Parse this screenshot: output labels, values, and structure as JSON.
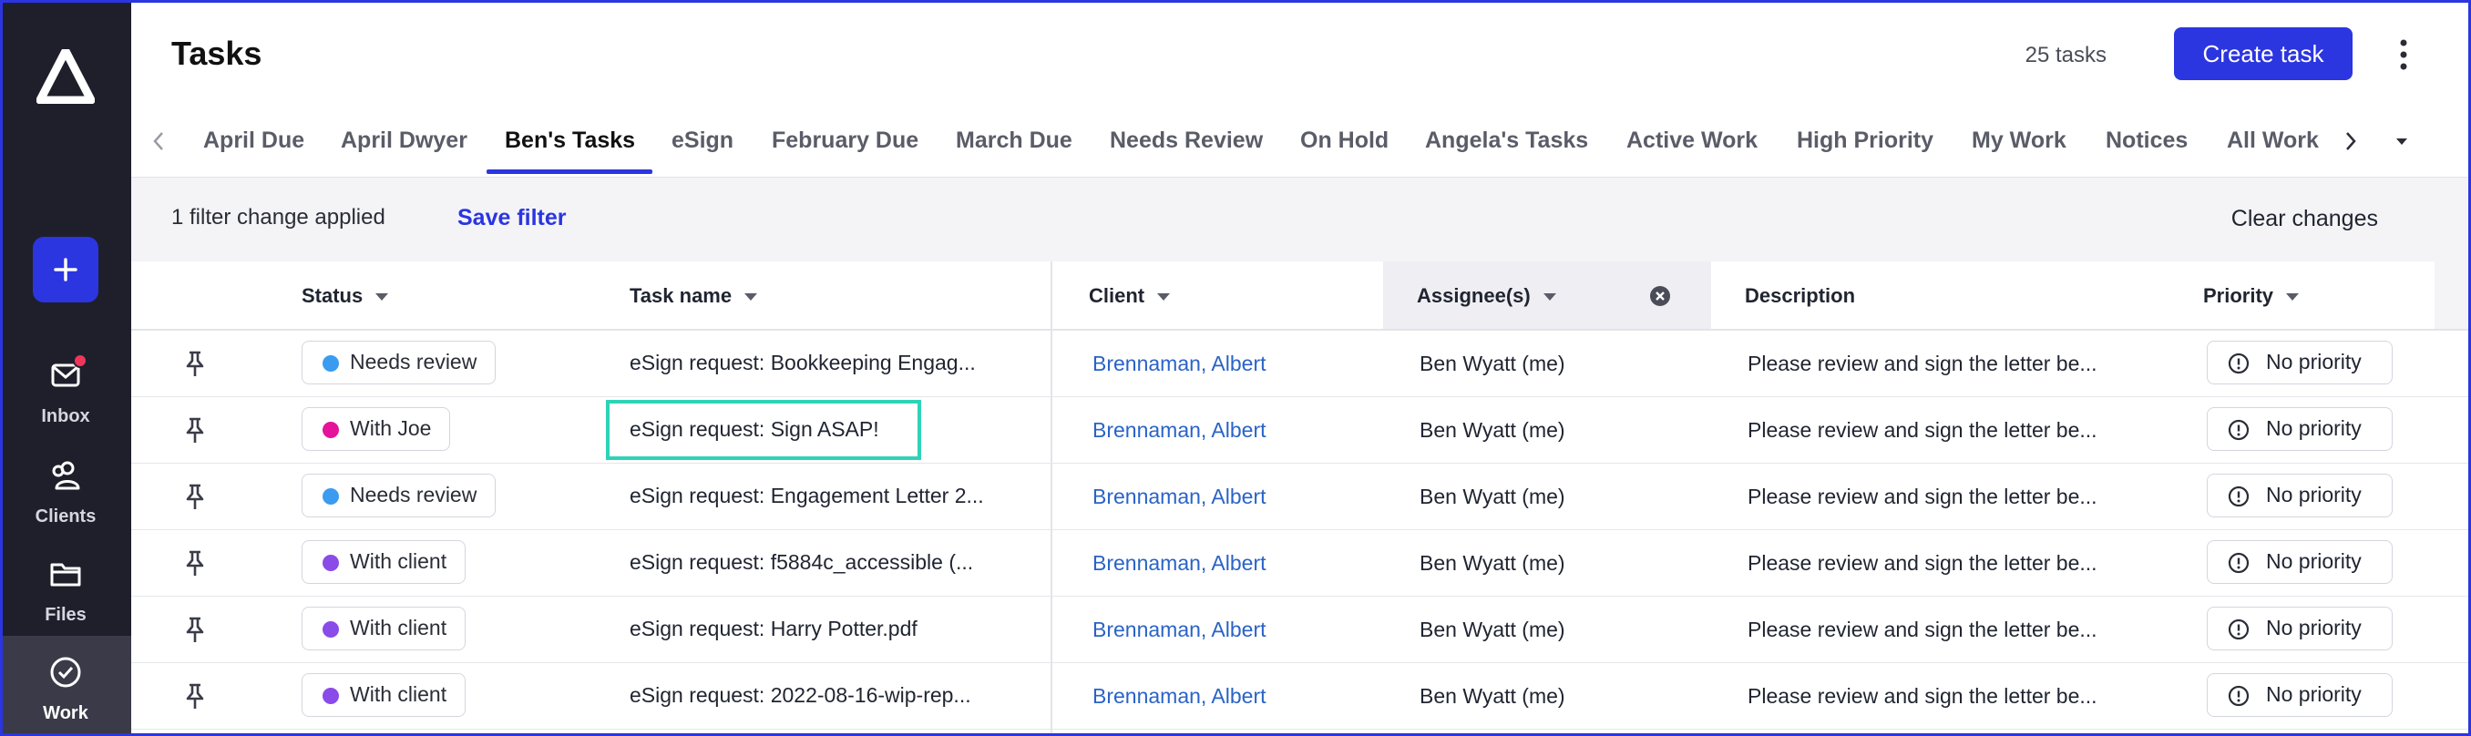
{
  "sidebar": {
    "nav": [
      {
        "label": "Inbox",
        "icon": "mail-icon"
      },
      {
        "label": "Clients",
        "icon": "users-icon"
      },
      {
        "label": "Files",
        "icon": "folder-icon"
      },
      {
        "label": "Work",
        "icon": "check-circle-icon"
      }
    ]
  },
  "header": {
    "title": "Tasks",
    "task_count": "25 tasks",
    "create_label": "Create task"
  },
  "tabs": [
    "April Due",
    "April Dwyer",
    "Ben's Tasks",
    "eSign",
    "February Due",
    "March Due",
    "Needs Review",
    "On Hold",
    "Angela's Tasks",
    "Active Work",
    "High Priority",
    "My Work",
    "Notices",
    "All Work"
  ],
  "active_tab": "Ben's Tasks",
  "filter_bar": {
    "status_text": "1 filter change applied",
    "save_label": "Save filter",
    "clear_label": "Clear changes"
  },
  "columns": {
    "status": "Status",
    "task_name": "Task name",
    "client": "Client",
    "assignees": "Assignee(s)",
    "description": "Description",
    "priority": "Priority"
  },
  "status_colors": {
    "Needs review": "#3a9bf0",
    "With Joe": "#e5129a",
    "With client": "#8a4be8"
  },
  "rows": [
    {
      "status": "Needs review",
      "task": "eSign request: Bookkeeping Engag...",
      "client": "Brennaman, Albert",
      "assignee": "Ben Wyatt (me)",
      "description": "Please review and sign the letter be...",
      "priority": "No priority"
    },
    {
      "status": "With Joe",
      "task": "eSign request: Sign ASAP!",
      "client": "Brennaman, Albert",
      "assignee": "Ben Wyatt (me)",
      "description": "Please review and sign the letter be...",
      "priority": "No priority"
    },
    {
      "status": "Needs review",
      "task": "eSign request: Engagement Letter 2...",
      "client": "Brennaman, Albert",
      "assignee": "Ben Wyatt (me)",
      "description": "Please review and sign the letter be...",
      "priority": "No priority"
    },
    {
      "status": "With client",
      "task": "eSign request: f5884c_accessible (...",
      "client": "Brennaman, Albert",
      "assignee": "Ben Wyatt (me)",
      "description": "Please review and sign the letter be...",
      "priority": "No priority"
    },
    {
      "status": "With client",
      "task": "eSign request: Harry Potter.pdf",
      "client": "Brennaman, Albert",
      "assignee": "Ben Wyatt (me)",
      "description": "Please review and sign the letter be...",
      "priority": "No priority"
    },
    {
      "status": "With client",
      "task": "eSign request: 2022-08-16-wip-rep...",
      "client": "Brennaman, Albert",
      "assignee": "Ben Wyatt (me)",
      "description": "Please review and sign the letter be...",
      "priority": "No priority"
    }
  ],
  "highlighted_row": 1
}
